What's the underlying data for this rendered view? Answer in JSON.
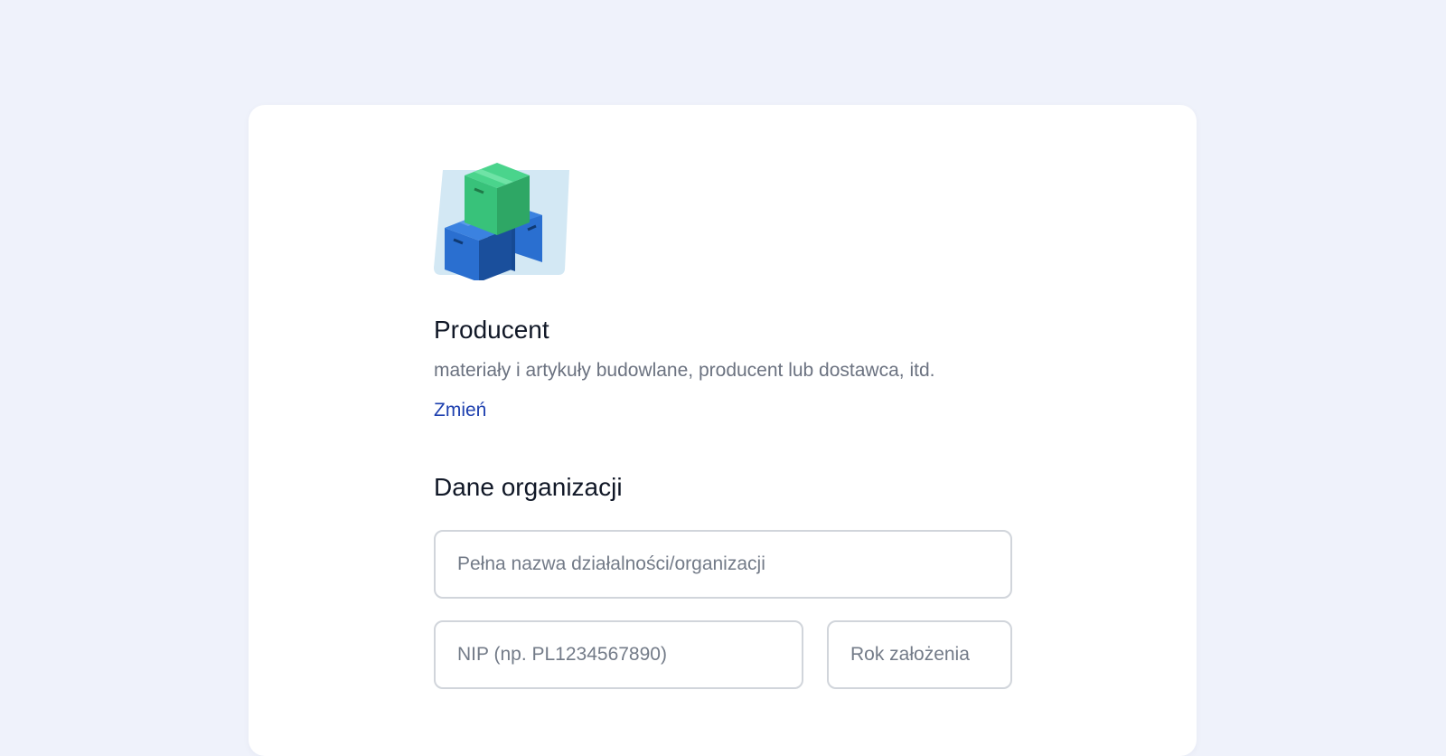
{
  "category": {
    "illustration_icon": "stacked-boxes-icon",
    "title": "Producent",
    "description": "materiały i artykuły budowlane, producent lub dostawca, itd.",
    "change_label": "Zmień"
  },
  "organization": {
    "section_title": "Dane organizacji",
    "full_name": {
      "value": "",
      "placeholder": "Pełna nazwa działalności/organizacji"
    },
    "nip": {
      "value": "",
      "placeholder": "NIP (np. PL1234567890)"
    },
    "year_founded": {
      "value": "",
      "placeholder": "Rok założenia"
    }
  },
  "colors": {
    "page_background": "#eff2fb",
    "card_background": "#ffffff",
    "link": "#1e40af",
    "title_text": "#111827",
    "muted_text": "#6b7280",
    "field_border": "#d1d5db",
    "box_green": "#34c27a",
    "box_blue": "#2a6fd0",
    "illustration_backdrop": "#d3e8f4"
  }
}
